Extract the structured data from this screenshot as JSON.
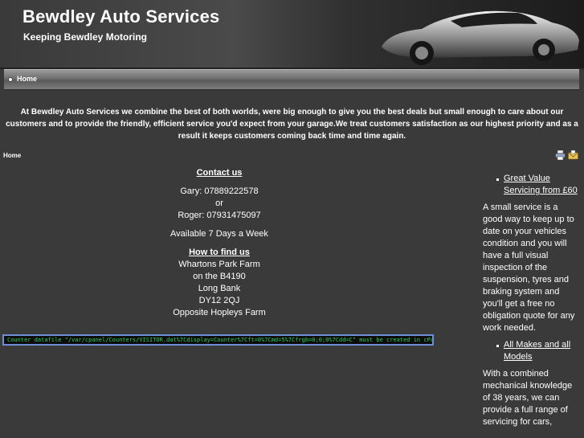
{
  "header": {
    "title": "Bewdley Auto Services",
    "tagline": "Keeping Bewdley Motoring"
  },
  "nav": {
    "home": "Home"
  },
  "intro": "At Bewdley Auto Services we combine the best of both worlds, were big enough to give you the best deals but small enough to care about our customers and to provide the friendly, efficient service you'd expect from your garage.We treat customers satisfaction as our highest priority and as a result it keeps customers coming back time  and time again.",
  "breadcrumb": "Home",
  "contact": {
    "heading": "Contact us",
    "line1": "Gary: 07889222578",
    "or": "or",
    "line2": "Roger: 07931475097",
    "availability": "Available 7 Days a Week",
    "find_heading": "How to find us",
    "address": [
      "Whartons Park Farm",
      "on the B4190",
      "Long Bank",
      "DY12 2QJ",
      "Opposite Hopleys Farm"
    ]
  },
  "counter": "Counter datafile \"/var/cpanel/Counters/VISITOR.dat%7Cdisplay=Counter%7Cft=0%7Cmd=5%7Cfrgb=0;0;0%7Cdd=C\" must be created in cPanel first!",
  "sidebar": {
    "link1": "Great Value Servicing from £60",
    "para1": "A small service is a good way to keep up to date on your vehicles condition and you will have a full visual inspection of the suspension, tyres and braking system and you'll get a free no obligation quote for any work needed.",
    "link2": "All Makes and all Models",
    "para2": "With a combined mechanical knowledge of 38 years, we can provide a full range of servicing for cars,"
  },
  "icons": {
    "print": "print-icon",
    "email": "email-icon"
  }
}
